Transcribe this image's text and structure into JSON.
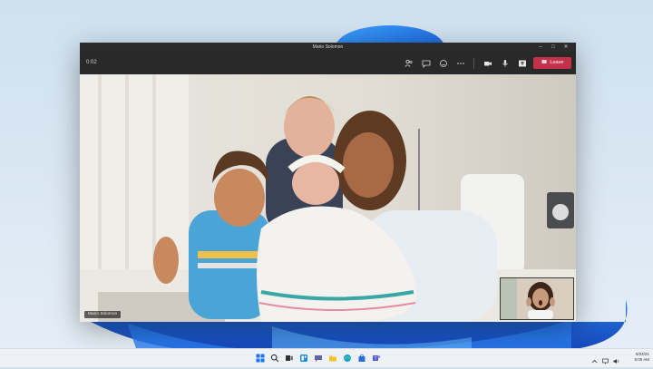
{
  "window": {
    "title": "Mario Solomon",
    "controls": [
      "minimize-icon",
      "maximize-icon",
      "close-icon"
    ]
  },
  "toolbar": {
    "timer": "0:02",
    "icons": [
      "people-icon",
      "chat-icon",
      "reactions-icon",
      "more-icon",
      "camera-icon",
      "microphone-icon",
      "share-icon"
    ],
    "leave_label": "Leave",
    "leave_color": "#c4314b"
  },
  "video": {
    "participant_name": "Mario Solomon"
  },
  "taskbar": {
    "apps": [
      "start-icon",
      "search-icon",
      "task-view-icon",
      "widgets-icon",
      "teams-chat-icon",
      "file-explorer-icon",
      "edge-icon",
      "store-icon",
      "teams-icon"
    ],
    "tray_icons": [
      "chevron-up-icon",
      "network-icon",
      "volume-icon"
    ],
    "date": "6/24/21",
    "time": "8:00 AM"
  }
}
